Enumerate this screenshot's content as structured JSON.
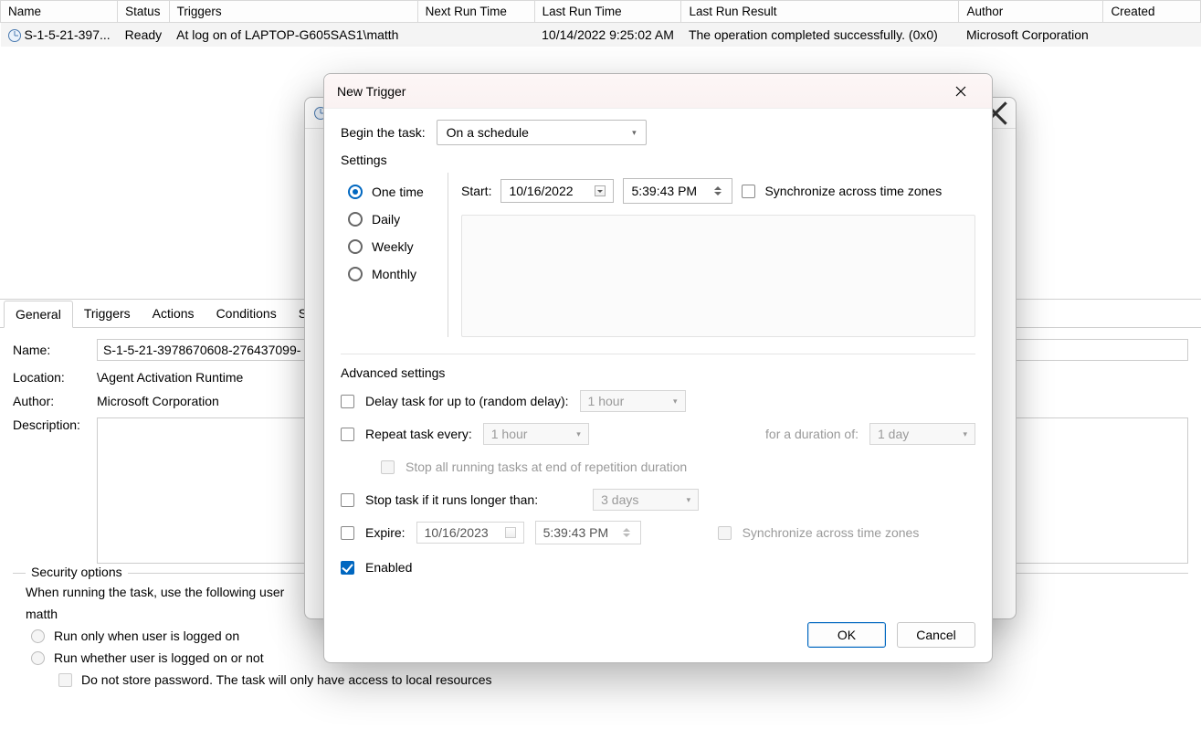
{
  "table": {
    "headers": [
      "Name",
      "Status",
      "Triggers",
      "Next Run Time",
      "Last Run Time",
      "Last Run Result",
      "Author",
      "Created"
    ],
    "row": {
      "name": "S-1-5-21-397...",
      "status": "Ready",
      "triggers": "At log on of LAPTOP-G605SAS1\\matth",
      "nextrun": "",
      "lastrun": "10/14/2022 9:25:02 AM",
      "lastresult": "The operation completed successfully. (0x0)",
      "author": "Microsoft Corporation",
      "created": ""
    }
  },
  "tabs": {
    "general": "General",
    "triggers": "Triggers",
    "actions": "Actions",
    "conditions": "Conditions",
    "settings": "Settings"
  },
  "general_panel": {
    "name_label": "Name:",
    "name_value": "S-1-5-21-3978670608-276437099-",
    "location_label": "Location:",
    "location_value": "\\Agent Activation Runtime",
    "author_label": "Author:",
    "author_value": "Microsoft Corporation",
    "description_label": "Description:"
  },
  "security": {
    "legend": "Security options",
    "when_running": "When running the task, use the following user",
    "user": "matth",
    "run_logged_on": "Run only when user is logged on",
    "run_whether": "Run whether user is logged on or not",
    "no_store_pw": "Do not store password.  The task will only have access to local resources"
  },
  "dialog": {
    "title": "New Trigger",
    "begin_label": "Begin the task:",
    "begin_value": "On a schedule",
    "settings_label": "Settings",
    "recur": {
      "one": "One time",
      "daily": "Daily",
      "weekly": "Weekly",
      "monthly": "Monthly"
    },
    "start_label": "Start:",
    "start_date": "10/16/2022",
    "start_time": "5:39:43 PM",
    "sync_tz": "Synchronize across time zones",
    "adv_label": "Advanced settings",
    "delay_label": "Delay task for up to (random delay):",
    "delay_value": "1 hour",
    "repeat_label": "Repeat task every:",
    "repeat_value": "1 hour",
    "duration_label": "for a duration of:",
    "duration_value": "1 day",
    "stop_all": "Stop all running tasks at end of repetition duration",
    "stop_if_label": "Stop task if it runs longer than:",
    "stop_if_value": "3 days",
    "expire_label": "Expire:",
    "expire_date": "10/16/2023",
    "expire_time": "5:39:43 PM",
    "expire_sync": "Synchronize across time zones",
    "enabled": "Enabled",
    "ok": "OK",
    "cancel": "Cancel"
  }
}
